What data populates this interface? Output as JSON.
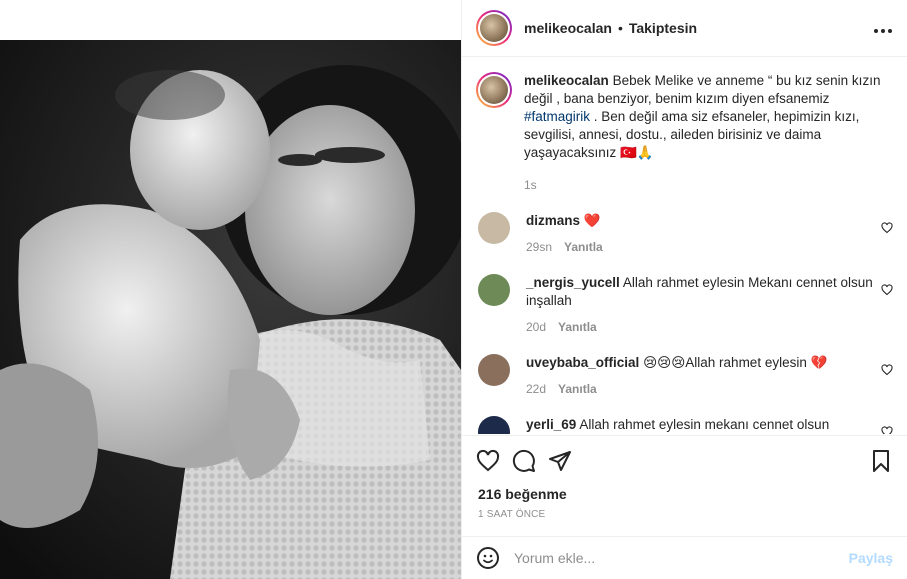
{
  "post": {
    "username": "melikeocalan",
    "separator": "•",
    "follow_status": "Takiptesin",
    "more_label": "•••"
  },
  "caption": {
    "username": "melikeocalan",
    "text_before": "Bebek Melike ve anneme “ bu kız senin kızın değil , bana benziyor, benim kızım diyen efsanemiz ",
    "hashtag": "#fatmagirik",
    "text_after": " . Ben değil ama siz efsaneler, hepimizin kızı, sevgilisi, annesi, dostu., aileden birisiniz ve daima yaşayacaksınız 🇹🇷🙏",
    "time": "1s"
  },
  "comments": [
    {
      "username": "dizmans",
      "text": "❤️",
      "time": "29sn",
      "reply": "Yanıtla",
      "avatar_color": "#c7b9a3"
    },
    {
      "username": "_nergis_yucell",
      "text": "Allah rahmet eylesin Mekanı cennet olsun inşallah",
      "time": "20d",
      "reply": "Yanıtla",
      "avatar_color": "#6d8a57"
    },
    {
      "username": "uveybaba_official",
      "text": "😢😢😢Allah rahmet eylesin 💔",
      "time": "22d",
      "reply": "Yanıtla",
      "avatar_color": "#8a6f5c"
    },
    {
      "username": "yerli_69",
      "text": "Allah rahmet eylesin mekanı cennet olsun inşallah",
      "time": "",
      "reply": "",
      "avatar_color": "#1d2a4a"
    }
  ],
  "actions": {
    "likes": "216 beğenme",
    "posted_ago": "1 SAAT ÖNCE"
  },
  "add_comment": {
    "placeholder": "Yorum ekle...",
    "post_label": "Paylaş"
  },
  "colors": {
    "link": "#00376b",
    "muted": "#8e8e8e",
    "post_button_disabled": "#b3dbff",
    "heart": "#ed4956"
  },
  "icons": [
    "more-icon",
    "heart-icon",
    "comment-icon",
    "share-icon",
    "bookmark-icon",
    "emoji-icon"
  ]
}
